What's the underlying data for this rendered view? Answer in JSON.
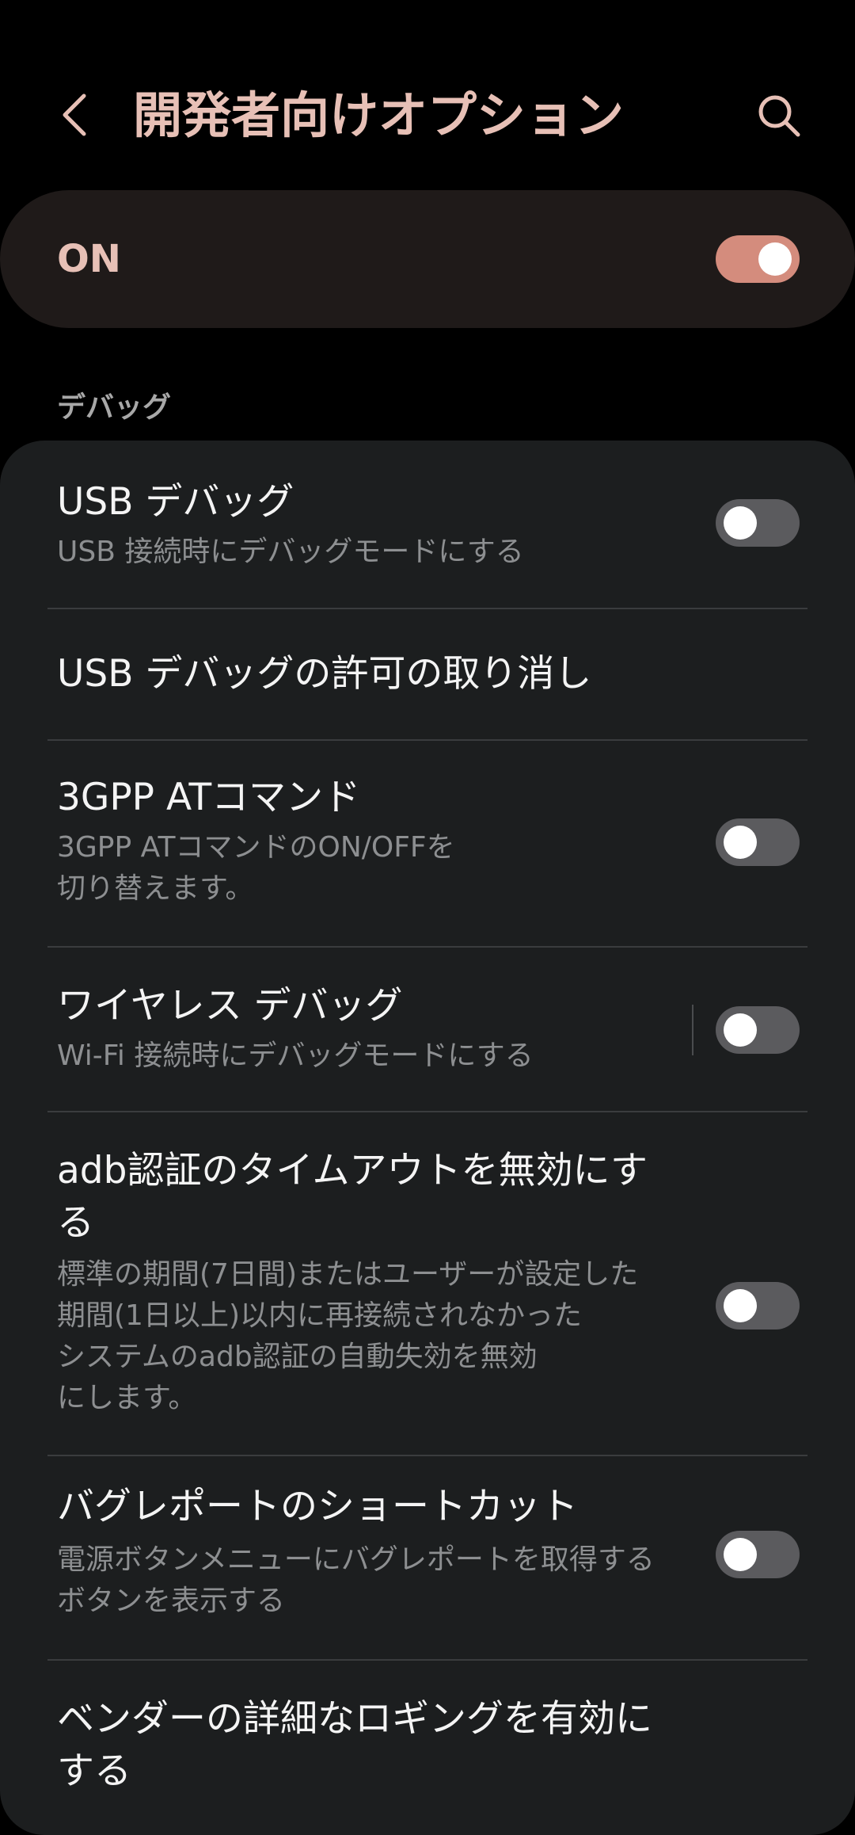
{
  "header": {
    "title": "開発者向けオプション",
    "back_icon": "chevron-left-icon",
    "search_icon": "search-icon"
  },
  "master": {
    "label": "ON",
    "enabled": true
  },
  "section": {
    "title": "デバッグ"
  },
  "items": [
    {
      "title": "USB デバッグ",
      "subtitle": "USB 接続時にデバッグモードにする",
      "toggle": false
    },
    {
      "title": "USB デバッグの許可の取り消し"
    },
    {
      "title": "3GPP ATコマンド",
      "subtitle_line1": "3GPP ATコマンドのON/OFFを",
      "subtitle_line2": "切り替えます。",
      "toggle": false
    },
    {
      "title": "ワイヤレス デバッグ",
      "subtitle": "Wi-Fi 接続時にデバッグモードにする",
      "toggle": false
    },
    {
      "title_line1": "adb認証のタイムアウトを無効にす",
      "title_line2": "る",
      "subtitle_line1": "標準の期間(7日間)またはユーザーが設定した",
      "subtitle_line2": "期間(1日以上)以内に再接続されなかった",
      "subtitle_line3": "システムのadb認証の自動失効を無効",
      "subtitle_line4": "にします。",
      "toggle": false
    },
    {
      "title": "バグレポートのショートカット",
      "subtitle_line1": "電源ボタンメニューにバグレポートを取得する",
      "subtitle_line2": "ボタンを表示する",
      "toggle": false
    },
    {
      "title_line1": "ベンダーの詳細なロギングを有効に",
      "title_line2": "する"
    }
  ],
  "colors": {
    "background": "#000000",
    "accent": "#e7c0b6",
    "toggle_on": "#d48c7d",
    "toggle_off": "#5b5b5e",
    "card": "#1c1e1f"
  }
}
